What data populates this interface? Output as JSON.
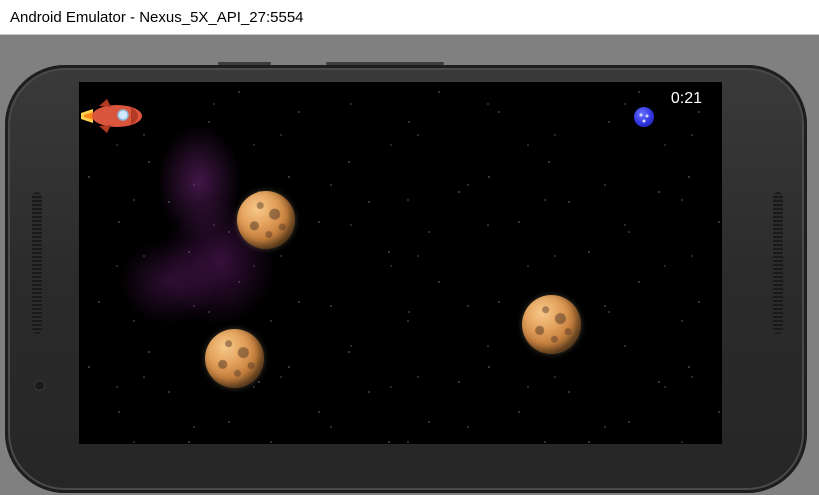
{
  "window": {
    "title": "Android Emulator - Nexus_5X_API_27:5554"
  },
  "game": {
    "timer": "0:21",
    "sprites": {
      "player": "rocket-icon",
      "obstacles": [
        "asteroid-icon",
        "asteroid-icon",
        "asteroid-icon"
      ],
      "pickup": "blue-orb-icon"
    },
    "colors": {
      "background": "#000000",
      "nebula": "#7a2a86",
      "rocket_body": "#d9553b",
      "asteroid": "#d99a55",
      "orb": "#2f34e0"
    }
  }
}
